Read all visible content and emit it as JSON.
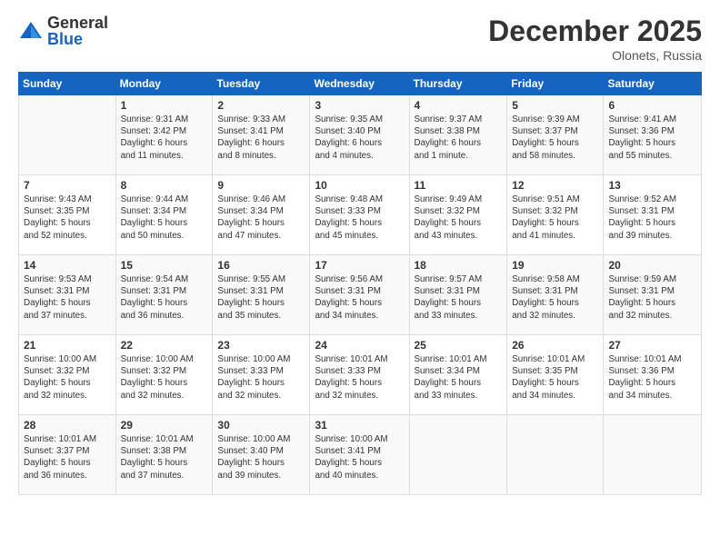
{
  "logo": {
    "general": "General",
    "blue": "Blue"
  },
  "header": {
    "month": "December 2025",
    "location": "Olonets, Russia"
  },
  "weekdays": [
    "Sunday",
    "Monday",
    "Tuesday",
    "Wednesday",
    "Thursday",
    "Friday",
    "Saturday"
  ],
  "weeks": [
    [
      {
        "day": "",
        "info": ""
      },
      {
        "day": "1",
        "info": "Sunrise: 9:31 AM\nSunset: 3:42 PM\nDaylight: 6 hours\nand 11 minutes."
      },
      {
        "day": "2",
        "info": "Sunrise: 9:33 AM\nSunset: 3:41 PM\nDaylight: 6 hours\nand 8 minutes."
      },
      {
        "day": "3",
        "info": "Sunrise: 9:35 AM\nSunset: 3:40 PM\nDaylight: 6 hours\nand 4 minutes."
      },
      {
        "day": "4",
        "info": "Sunrise: 9:37 AM\nSunset: 3:38 PM\nDaylight: 6 hours\nand 1 minute."
      },
      {
        "day": "5",
        "info": "Sunrise: 9:39 AM\nSunset: 3:37 PM\nDaylight: 5 hours\nand 58 minutes."
      },
      {
        "day": "6",
        "info": "Sunrise: 9:41 AM\nSunset: 3:36 PM\nDaylight: 5 hours\nand 55 minutes."
      }
    ],
    [
      {
        "day": "7",
        "info": "Sunrise: 9:43 AM\nSunset: 3:35 PM\nDaylight: 5 hours\nand 52 minutes."
      },
      {
        "day": "8",
        "info": "Sunrise: 9:44 AM\nSunset: 3:34 PM\nDaylight: 5 hours\nand 50 minutes."
      },
      {
        "day": "9",
        "info": "Sunrise: 9:46 AM\nSunset: 3:34 PM\nDaylight: 5 hours\nand 47 minutes."
      },
      {
        "day": "10",
        "info": "Sunrise: 9:48 AM\nSunset: 3:33 PM\nDaylight: 5 hours\nand 45 minutes."
      },
      {
        "day": "11",
        "info": "Sunrise: 9:49 AM\nSunset: 3:32 PM\nDaylight: 5 hours\nand 43 minutes."
      },
      {
        "day": "12",
        "info": "Sunrise: 9:51 AM\nSunset: 3:32 PM\nDaylight: 5 hours\nand 41 minutes."
      },
      {
        "day": "13",
        "info": "Sunrise: 9:52 AM\nSunset: 3:31 PM\nDaylight: 5 hours\nand 39 minutes."
      }
    ],
    [
      {
        "day": "14",
        "info": "Sunrise: 9:53 AM\nSunset: 3:31 PM\nDaylight: 5 hours\nand 37 minutes."
      },
      {
        "day": "15",
        "info": "Sunrise: 9:54 AM\nSunset: 3:31 PM\nDaylight: 5 hours\nand 36 minutes."
      },
      {
        "day": "16",
        "info": "Sunrise: 9:55 AM\nSunset: 3:31 PM\nDaylight: 5 hours\nand 35 minutes."
      },
      {
        "day": "17",
        "info": "Sunrise: 9:56 AM\nSunset: 3:31 PM\nDaylight: 5 hours\nand 34 minutes."
      },
      {
        "day": "18",
        "info": "Sunrise: 9:57 AM\nSunset: 3:31 PM\nDaylight: 5 hours\nand 33 minutes."
      },
      {
        "day": "19",
        "info": "Sunrise: 9:58 AM\nSunset: 3:31 PM\nDaylight: 5 hours\nand 32 minutes."
      },
      {
        "day": "20",
        "info": "Sunrise: 9:59 AM\nSunset: 3:31 PM\nDaylight: 5 hours\nand 32 minutes."
      }
    ],
    [
      {
        "day": "21",
        "info": "Sunrise: 10:00 AM\nSunset: 3:32 PM\nDaylight: 5 hours\nand 32 minutes."
      },
      {
        "day": "22",
        "info": "Sunrise: 10:00 AM\nSunset: 3:32 PM\nDaylight: 5 hours\nand 32 minutes."
      },
      {
        "day": "23",
        "info": "Sunrise: 10:00 AM\nSunset: 3:33 PM\nDaylight: 5 hours\nand 32 minutes."
      },
      {
        "day": "24",
        "info": "Sunrise: 10:01 AM\nSunset: 3:33 PM\nDaylight: 5 hours\nand 32 minutes."
      },
      {
        "day": "25",
        "info": "Sunrise: 10:01 AM\nSunset: 3:34 PM\nDaylight: 5 hours\nand 33 minutes."
      },
      {
        "day": "26",
        "info": "Sunrise: 10:01 AM\nSunset: 3:35 PM\nDaylight: 5 hours\nand 34 minutes."
      },
      {
        "day": "27",
        "info": "Sunrise: 10:01 AM\nSunset: 3:36 PM\nDaylight: 5 hours\nand 34 minutes."
      }
    ],
    [
      {
        "day": "28",
        "info": "Sunrise: 10:01 AM\nSunset: 3:37 PM\nDaylight: 5 hours\nand 36 minutes."
      },
      {
        "day": "29",
        "info": "Sunrise: 10:01 AM\nSunset: 3:38 PM\nDaylight: 5 hours\nand 37 minutes."
      },
      {
        "day": "30",
        "info": "Sunrise: 10:00 AM\nSunset: 3:40 PM\nDaylight: 5 hours\nand 39 minutes."
      },
      {
        "day": "31",
        "info": "Sunrise: 10:00 AM\nSunset: 3:41 PM\nDaylight: 5 hours\nand 40 minutes."
      },
      {
        "day": "",
        "info": ""
      },
      {
        "day": "",
        "info": ""
      },
      {
        "day": "",
        "info": ""
      }
    ]
  ]
}
